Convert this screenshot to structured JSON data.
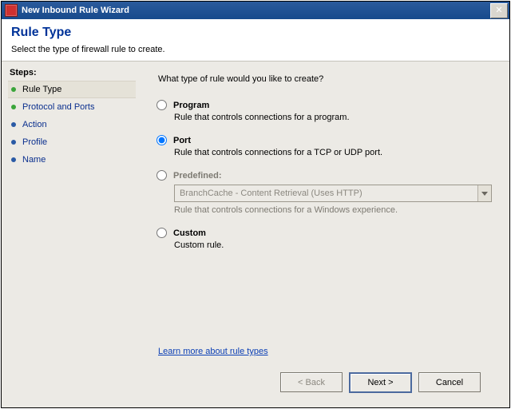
{
  "window": {
    "title": "New Inbound Rule Wizard"
  },
  "header": {
    "title": "Rule Type",
    "subtitle": "Select the type of firewall rule to create."
  },
  "sidebar": {
    "heading": "Steps:",
    "items": [
      {
        "label": "Rule Type"
      },
      {
        "label": "Protocol and Ports"
      },
      {
        "label": "Action"
      },
      {
        "label": "Profile"
      },
      {
        "label": "Name"
      }
    ]
  },
  "main": {
    "prompt": "What type of rule would you like to create?",
    "options": {
      "program": {
        "label": "Program",
        "desc": "Rule that controls connections for a program."
      },
      "port": {
        "label": "Port",
        "desc": "Rule that controls connections for a TCP or UDP port."
      },
      "predefined": {
        "label": "Predefined:",
        "combo": "BranchCache - Content Retrieval (Uses HTTP)",
        "desc": "Rule that controls connections for a Windows experience."
      },
      "custom": {
        "label": "Custom",
        "desc": "Custom rule."
      }
    },
    "selected": "port",
    "learn_link": "Learn more about rule types"
  },
  "footer": {
    "back": "< Back",
    "next": "Next >",
    "cancel": "Cancel"
  }
}
